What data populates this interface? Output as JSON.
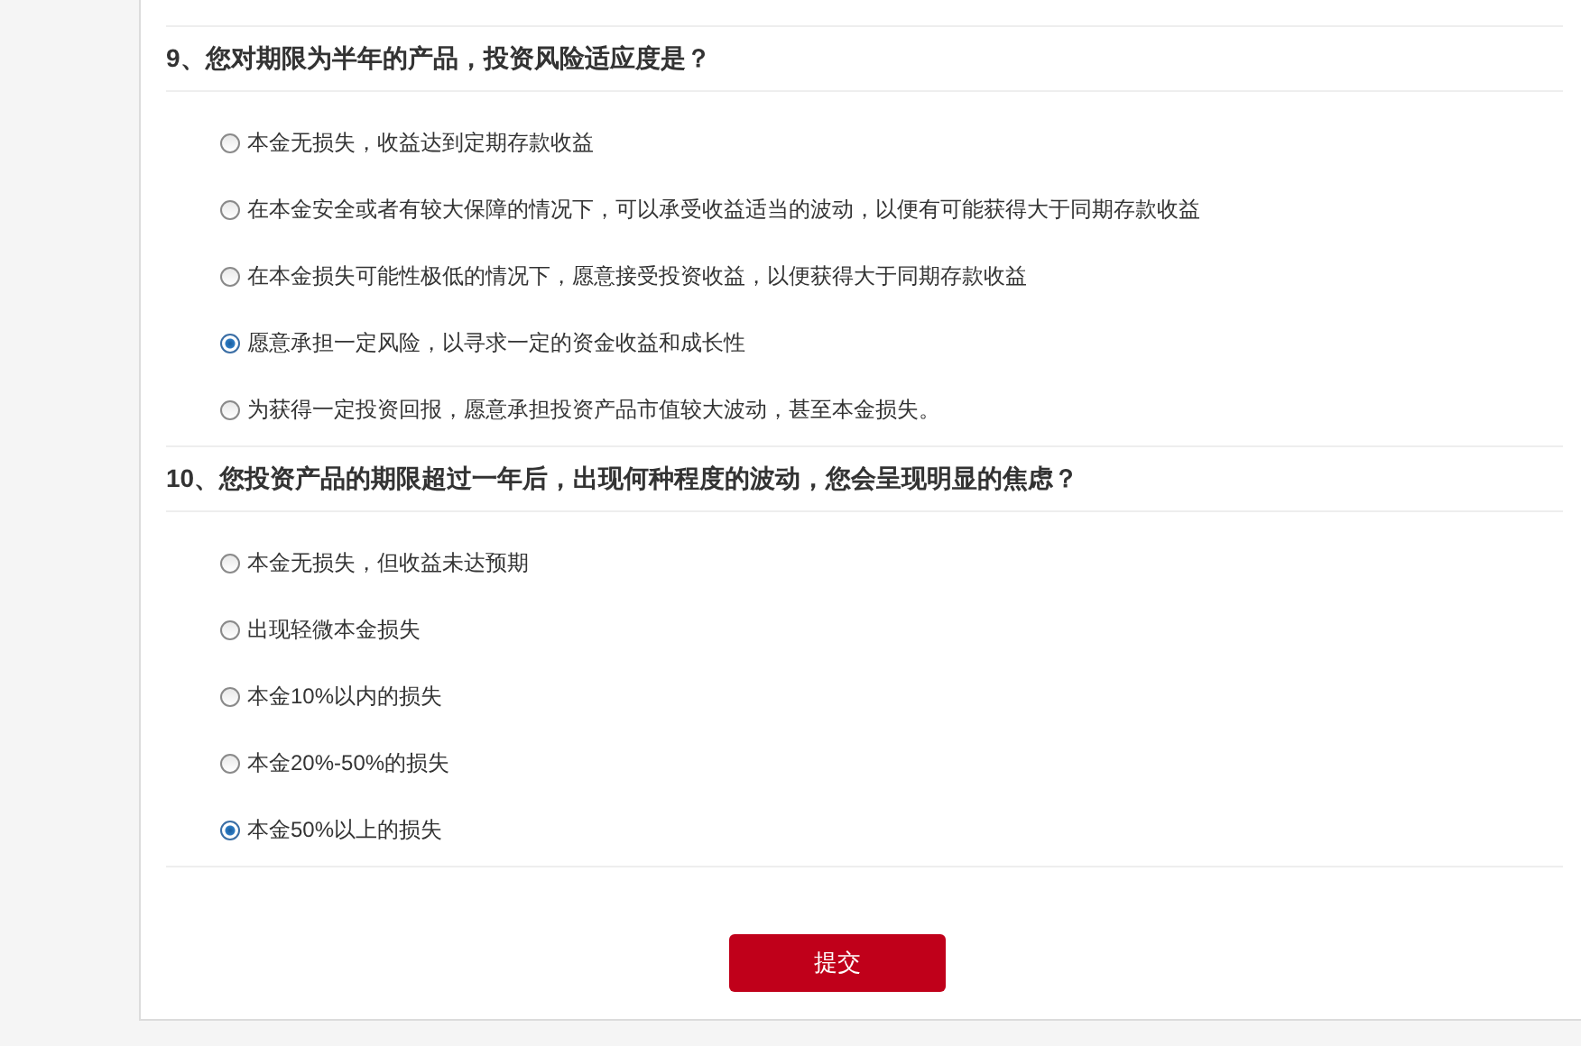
{
  "questions": [
    {
      "title": "9、您对期限为半年的产品，投资风险适应度是？",
      "options": [
        {
          "label": "本金无损失，收益达到定期存款收益",
          "selected": false
        },
        {
          "label": "在本金安全或者有较大保障的情况下，可以承受收益适当的波动，以便有可能获得大于同期存款收益",
          "selected": false
        },
        {
          "label": "在本金损失可能性极低的情况下，愿意接受投资收益，以便获得大于同期存款收益",
          "selected": false
        },
        {
          "label": "愿意承担一定风险，以寻求一定的资金收益和成长性",
          "selected": true
        },
        {
          "label": "为获得一定投资回报，愿意承担投资产品市值较大波动，甚至本金损失。",
          "selected": false
        }
      ]
    },
    {
      "title": "10、您投资产品的期限超过一年后，出现何种程度的波动，您会呈现明显的焦虑？",
      "options": [
        {
          "label": "本金无损失，但收益未达预期",
          "selected": false
        },
        {
          "label": "出现轻微本金损失",
          "selected": false
        },
        {
          "label": "本金10%以内的损失",
          "selected": false
        },
        {
          "label": "本金20%-50%的损失",
          "selected": false
        },
        {
          "label": "本金50%以上的损失",
          "selected": true
        }
      ]
    }
  ],
  "submit": "提交"
}
